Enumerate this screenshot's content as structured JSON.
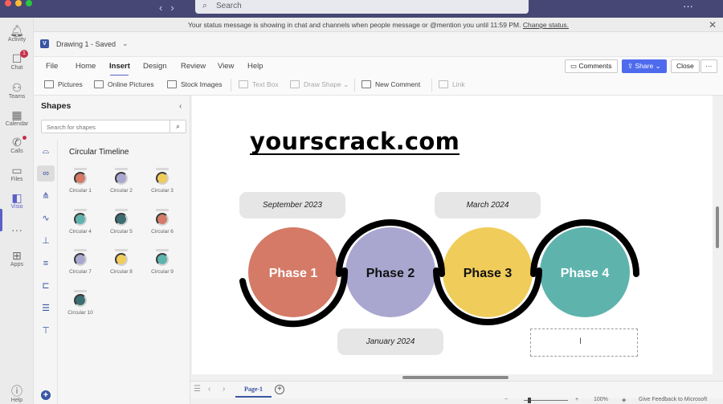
{
  "search": {
    "placeholder": "Search"
  },
  "window": {
    "more": "···"
  },
  "rail": {
    "items": [
      {
        "label": "Activity",
        "icon": "bell-icon"
      },
      {
        "label": "Chat",
        "icon": "chat-icon",
        "badge": "1"
      },
      {
        "label": "Teams",
        "icon": "teams-icon"
      },
      {
        "label": "Calendar",
        "icon": "calendar-icon"
      },
      {
        "label": "Calls",
        "icon": "phone-icon"
      },
      {
        "label": "Files",
        "icon": "file-icon"
      },
      {
        "label": "Visio",
        "icon": "visio-icon"
      },
      {
        "label": "···",
        "icon": "more-icon"
      },
      {
        "label": "Apps",
        "icon": "apps-icon"
      },
      {
        "label": "Help",
        "icon": "help-icon"
      }
    ]
  },
  "banner": {
    "text": "Your status message is showing in chat and channels when people message or @mention you until 11:59 PM.",
    "link": "Change status."
  },
  "doc": {
    "title": "Drawing 1  -  Saved"
  },
  "menu": {
    "tabs": [
      "File",
      "Home",
      "Insert",
      "Design",
      "Review",
      "View",
      "Help"
    ],
    "active": "Insert",
    "comments": "Comments",
    "share": "Share",
    "close": "Close",
    "more": "···"
  },
  "toolbar": {
    "pictures": "Pictures",
    "online_pictures": "Online Pictures",
    "stock_images": "Stock Images",
    "text_box": "Text Box",
    "draw_shape": "Draw Shape",
    "new_comment": "New Comment",
    "link": "Link"
  },
  "shapes": {
    "title": "Shapes",
    "search_placeholder": "Search for shapes",
    "stencil_name": "Circular Timeline",
    "items": [
      {
        "label": "Circular 1",
        "color": "#d47a66"
      },
      {
        "label": "Circular 2",
        "color": "#a9a6d0"
      },
      {
        "label": "Circular 3",
        "color": "#f0cd5a"
      },
      {
        "label": "Circular 4",
        "color": "#5fb3ad"
      },
      {
        "label": "Circular 5",
        "color": "#3c6e73"
      },
      {
        "label": "Circular 6",
        "color": "#d47a66"
      },
      {
        "label": "Circular 7",
        "color": "#a9a6d0"
      },
      {
        "label": "Circular 8",
        "color": "#f0cd5a"
      },
      {
        "label": "Circular 9",
        "color": "#5fb3ad"
      },
      {
        "label": "Circular 10",
        "color": "#3c6e73"
      }
    ]
  },
  "canvas": {
    "watermark": "yourscrack.com",
    "dates_top": [
      "September 2023",
      "March 2024"
    ],
    "dates_bottom": [
      "January 2024"
    ],
    "phases": [
      {
        "label": "Phase 1",
        "color": "#d47a66",
        "text_color": "#ffffff"
      },
      {
        "label": "Phase 2",
        "color": "#a9a6d0",
        "text_color": "#111111"
      },
      {
        "label": "Phase 3",
        "color": "#f0cd5a",
        "text_color": "#111111"
      },
      {
        "label": "Phase 4",
        "color": "#5fb3ad",
        "text_color": "#ffffff"
      }
    ],
    "cursor": "I"
  },
  "pagebar": {
    "page_tab": "Page-1"
  },
  "status": {
    "zoom_minus": "−",
    "zoom_plus": "+",
    "zoom": "100%",
    "feedback": "Give Feedback to Microsoft"
  }
}
